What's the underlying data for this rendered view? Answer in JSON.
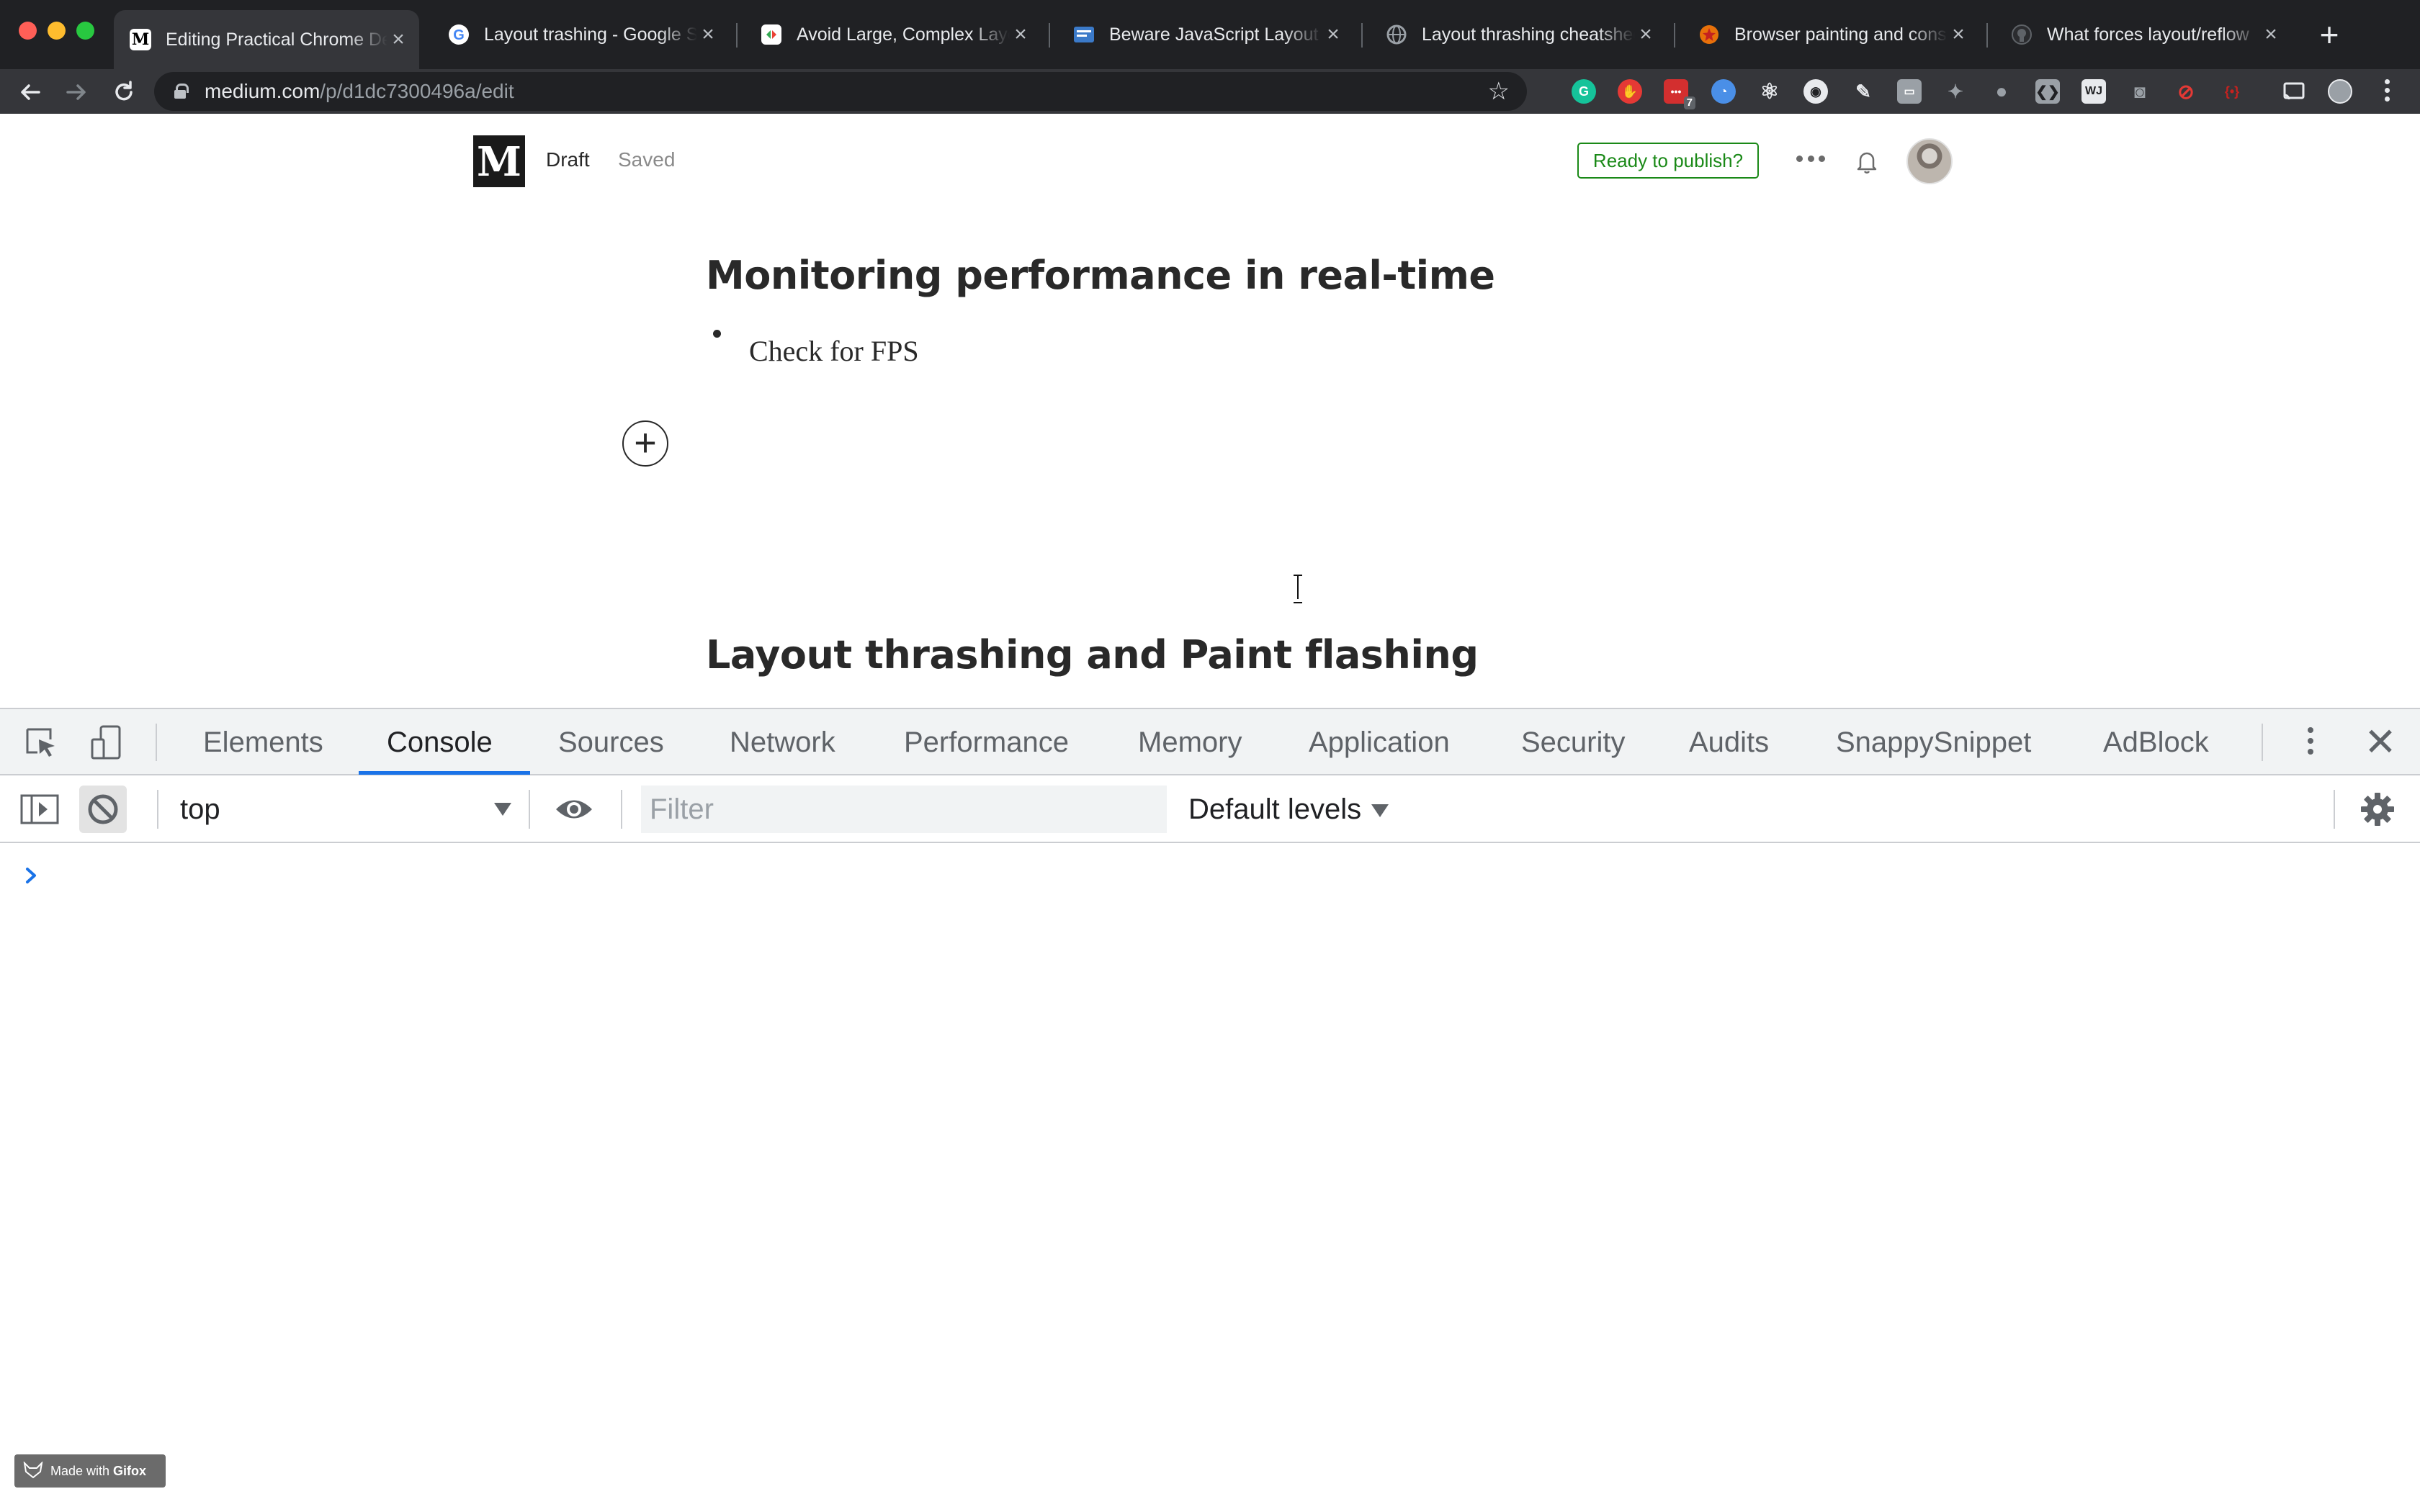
{
  "browser": {
    "tabs": [
      {
        "title": "Editing Practical Chrome Dev",
        "favicon": "M",
        "active": true
      },
      {
        "title": "Layout trashing - Google Search",
        "favicon": "G"
      },
      {
        "title": "Avoid Large, Complex Layouts",
        "favicon": "W"
      },
      {
        "title": "Beware JavaScript Layout Thrashing",
        "favicon": "B"
      },
      {
        "title": "Layout thrashing cheatsheet",
        "favicon": "globe"
      },
      {
        "title": "Browser painting and considerations",
        "favicon": "star"
      },
      {
        "title": "What forces layout/reflow",
        "favicon": "github"
      }
    ],
    "close_glyph": "×",
    "new_tab_glyph": "+",
    "address": {
      "host": "medium.com",
      "path": "/p/d1dc7300496a/edit"
    },
    "extensions": [
      "grammarly-icon",
      "adblock-icon",
      "todo-icon",
      "extension-icon",
      "react-icon",
      "github-icon",
      "pen-icon",
      "briefcase-icon",
      "puzzle-icon",
      "bulb-icon",
      "code-icon",
      "wj-icon",
      "camera-icon",
      "search-icon",
      "bracket-icon"
    ],
    "extension_badge": "7",
    "colors": {
      "frame": "#202124",
      "toolbar": "#35363a"
    }
  },
  "medium": {
    "logo": "M",
    "status": "Draft",
    "saved": "Saved",
    "publish_button": "Ready to publish?",
    "headings": [
      "Monitoring performance in real-time",
      "Layout thrashing and Paint flashing"
    ],
    "bullet": "Check for FPS",
    "add_button": "+",
    "accent": "#1a8917"
  },
  "devtools": {
    "tabs": [
      "Elements",
      "Console",
      "Sources",
      "Network",
      "Performance",
      "Memory",
      "Application",
      "Security",
      "Audits",
      "SnappySnippet",
      "AdBlock"
    ],
    "active_tab": "Console",
    "close_glyph": "✕",
    "console": {
      "context": "top",
      "filter_placeholder": "Filter",
      "filter_value": "",
      "levels": "Default levels"
    },
    "accent": "#1a73e8"
  },
  "watermark": {
    "prefix": "Made with ",
    "brand": "Gifox"
  }
}
